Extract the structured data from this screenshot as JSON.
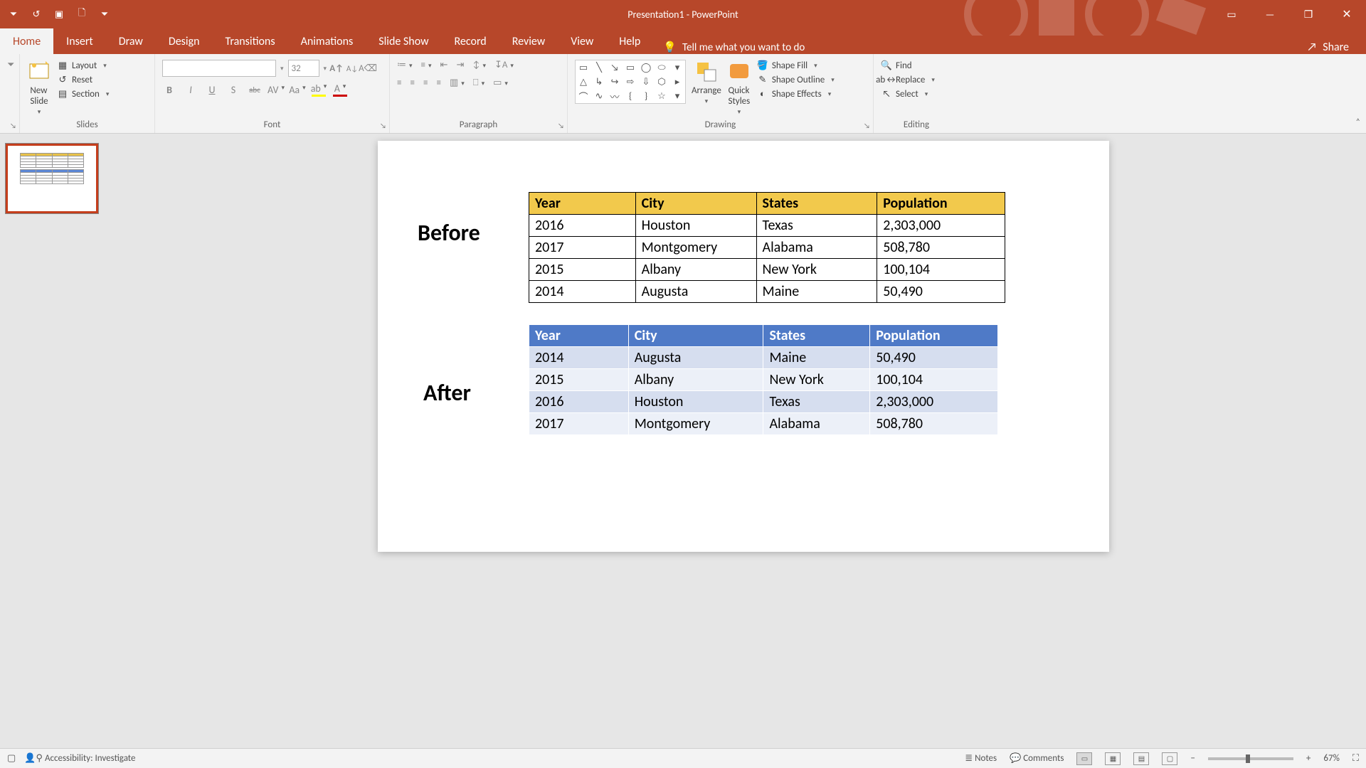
{
  "titlebar": {
    "title": "Presentation1  -  PowerPoint",
    "qat": {
      "undo": "↺",
      "redo": "↷",
      "start": "▢",
      "new": "🗋",
      "custom": "⏷"
    },
    "win": {
      "ribbon": "▭",
      "min": "—",
      "max": "❐",
      "close": "✕"
    }
  },
  "tabs": {
    "items": [
      "Home",
      "Insert",
      "Draw",
      "Design",
      "Transitions",
      "Animations",
      "Slide Show",
      "Record",
      "Review",
      "View",
      "Help"
    ],
    "tellme_placeholder": "Tell me what you want to do",
    "share": "Share"
  },
  "ribbon": {
    "slides": {
      "label": "Slides",
      "new_slide": "New\nSlide",
      "layout": "Layout",
      "reset": "Reset",
      "section": "Section"
    },
    "font": {
      "label": "Font",
      "size": "32",
      "bold": "B",
      "italic": "I",
      "underline": "U",
      "shadow": "S",
      "strike": "abc",
      "spacing": "AV",
      "case": "Aa",
      "clear": "⌀",
      "highlight": "A",
      "color": "A",
      "grow": "A▴",
      "shrink": "A▾"
    },
    "paragraph": {
      "label": "Paragraph"
    },
    "drawing": {
      "label": "Drawing",
      "arrange": "Arrange",
      "quick": "Quick\nStyles",
      "fill": "Shape Fill",
      "outline": "Shape Outline",
      "effects": "Shape Effects"
    },
    "editing": {
      "label": "Editing",
      "find": "Find",
      "replace": "Replace",
      "select": "Select"
    }
  },
  "slide": {
    "before_label": "Before",
    "after_label": "After",
    "headers": [
      "Year",
      "City",
      "States",
      "Population"
    ],
    "before_rows": [
      [
        "2016",
        "Houston",
        "Texas",
        "2,303,000"
      ],
      [
        "2017",
        "Montgomery",
        "Alabama",
        "508,780"
      ],
      [
        "2015",
        "Albany",
        "New York",
        "100,104"
      ],
      [
        "2014",
        "Augusta",
        "Maine",
        "50,490"
      ]
    ],
    "after_rows": [
      [
        "2014",
        "Augusta",
        "Maine",
        "50,490"
      ],
      [
        "2015",
        "Albany",
        "New York",
        "100,104"
      ],
      [
        "2016",
        "Houston",
        "Texas",
        "2,303,000"
      ],
      [
        "2017",
        "Montgomery",
        "Alabama",
        "508,780"
      ]
    ]
  },
  "statusbar": {
    "accessibility": "Accessibility: Investigate",
    "notes": "Notes",
    "comments": "Comments",
    "zoom": "67%"
  },
  "chart_data": [
    {
      "type": "table",
      "title": "Before",
      "columns": [
        "Year",
        "City",
        "States",
        "Population"
      ],
      "rows": [
        {
          "Year": 2016,
          "City": "Houston",
          "States": "Texas",
          "Population": 2303000
        },
        {
          "Year": 2017,
          "City": "Montgomery",
          "States": "Alabama",
          "Population": 508780
        },
        {
          "Year": 2015,
          "City": "Albany",
          "States": "New York",
          "Population": 100104
        },
        {
          "Year": 2014,
          "City": "Augusta",
          "States": "Maine",
          "Population": 50490
        }
      ]
    },
    {
      "type": "table",
      "title": "After",
      "columns": [
        "Year",
        "City",
        "States",
        "Population"
      ],
      "rows": [
        {
          "Year": 2014,
          "City": "Augusta",
          "States": "Maine",
          "Population": 50490
        },
        {
          "Year": 2015,
          "City": "Albany",
          "States": "New York",
          "Population": 100104
        },
        {
          "Year": 2016,
          "City": "Houston",
          "States": "Texas",
          "Population": 2303000
        },
        {
          "Year": 2017,
          "City": "Montgomery",
          "States": "Alabama",
          "Population": 508780
        }
      ]
    }
  ]
}
